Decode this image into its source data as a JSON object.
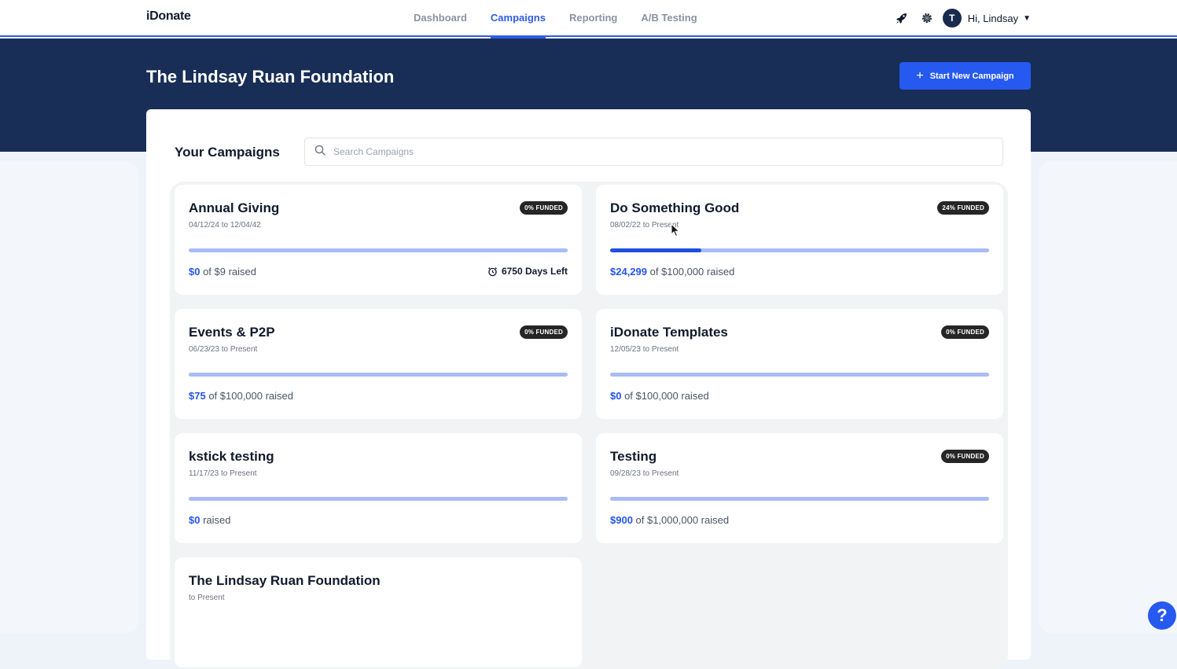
{
  "nav": {
    "logo": "iDonate",
    "links": [
      {
        "label": "Dashboard"
      },
      {
        "label": "Campaigns"
      },
      {
        "label": "Reporting"
      },
      {
        "label": "A/B Testing"
      }
    ],
    "avatar_initial": "T",
    "greeting": "Hi, Lindsay"
  },
  "banner": {
    "title": "The Lindsay Ruan Foundation",
    "start_button": "Start New Campaign"
  },
  "campaigns_section": {
    "title": "Your Campaigns",
    "search_placeholder": "Search Campaigns"
  },
  "campaigns": [
    {
      "title": "Annual Giving",
      "dates": "04/12/24 to 12/04/42",
      "badge": "0% FUNDED",
      "progress": 0,
      "amount": "$0",
      "goal_text": " of $9 raised",
      "days_left": "6750 Days Left"
    },
    {
      "title": "Do Something Good",
      "dates": "08/02/22 to Present",
      "badge": "24% FUNDED",
      "progress": 0.24,
      "amount": "$24,299",
      "goal_text": " of $100,000 raised",
      "days_left": ""
    },
    {
      "title": "Events & P2P",
      "dates": "06/23/23 to Present",
      "badge": "0% FUNDED",
      "progress": 0,
      "amount": "$75",
      "goal_text": " of $100,000 raised",
      "days_left": ""
    },
    {
      "title": "iDonate Templates",
      "dates": "12/05/23 to Present",
      "badge": "0% FUNDED",
      "progress": 0,
      "amount": "$0",
      "goal_text": " of $100,000 raised",
      "days_left": ""
    },
    {
      "title": "kstick testing",
      "dates": "11/17/23 to Present",
      "badge": "",
      "progress": 0,
      "amount": "$0",
      "goal_text": " raised",
      "days_left": ""
    },
    {
      "title": "Testing",
      "dates": "09/28/23 to Present",
      "badge": "0% FUNDED",
      "progress": 0,
      "amount": "$900",
      "goal_text": " of $1,000,000 raised",
      "days_left": ""
    },
    {
      "title": "The Lindsay Ruan Foundation",
      "dates": "to Present",
      "badge": "",
      "progress": 0,
      "amount": "",
      "goal_text": "",
      "days_left": ""
    }
  ],
  "help": {
    "label": "?"
  },
  "colors": {
    "accent": "#2659f0",
    "banner": "#182e56",
    "bar_track": "#a9bcf4",
    "bar_fill": "#1f4fe0"
  }
}
